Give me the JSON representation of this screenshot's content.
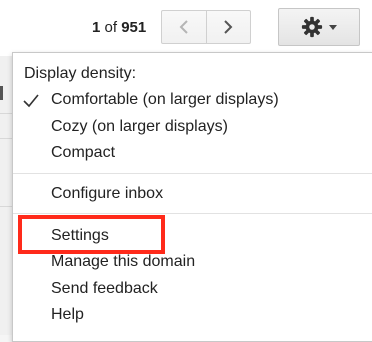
{
  "pagination": {
    "range": "1",
    "of_label": "of",
    "total": "951"
  },
  "icons": {
    "prev": "chevron-left-icon",
    "next": "chevron-right-icon",
    "settings": "gear-icon",
    "dropdown": "caret-down-icon",
    "selected": "check-icon"
  },
  "menu": {
    "heading": "Display density:",
    "density_options": [
      {
        "label": "Comfortable (on larger displays)",
        "selected": true
      },
      {
        "label": "Cozy (on larger displays)",
        "selected": false
      },
      {
        "label": "Compact",
        "selected": false
      }
    ],
    "configure_inbox": "Configure inbox",
    "settings": "Settings",
    "manage_domain": "Manage this domain",
    "send_feedback": "Send feedback",
    "help": "Help"
  },
  "colors": {
    "highlight": "#ff2a1a"
  }
}
